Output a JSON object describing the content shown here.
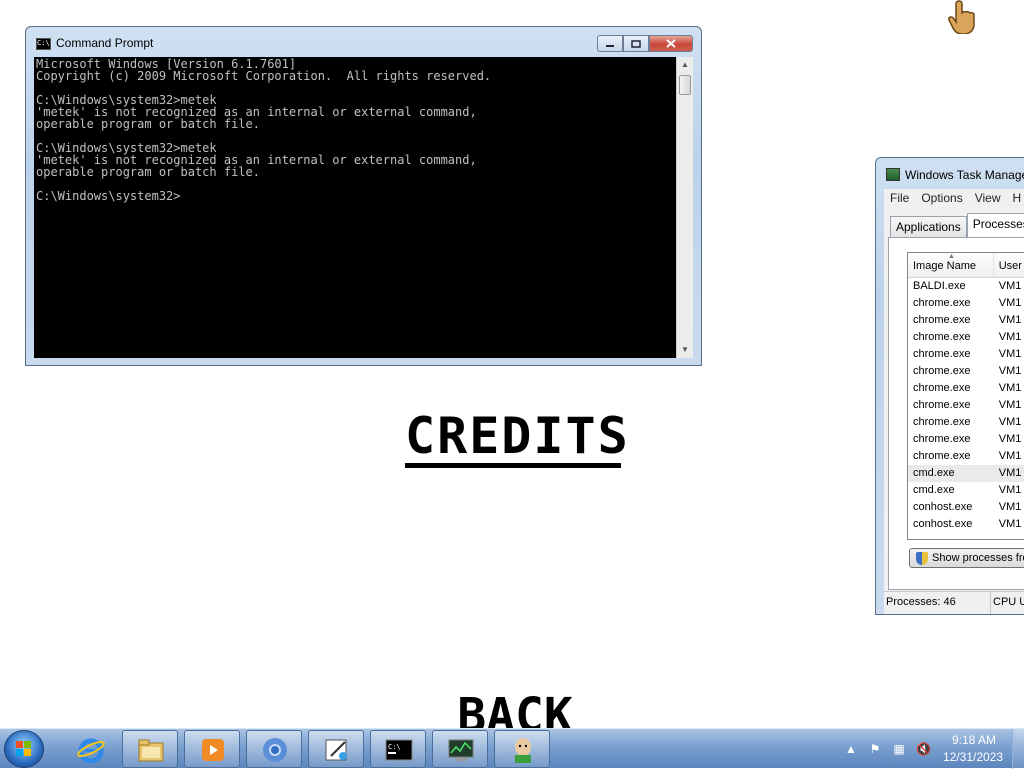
{
  "game": {
    "credits_title": "CREDITS",
    "back_label": "BACK"
  },
  "cmd": {
    "title": "Command Prompt",
    "icon": "cmd-icon",
    "lines": [
      "Microsoft Windows [Version 6.1.7601]",
      "Copyright (c) 2009 Microsoft Corporation.  All rights reserved.",
      "",
      "C:\\Windows\\system32>metek",
      "'metek' is not recognized as an internal or external command,",
      "operable program or batch file.",
      "",
      "C:\\Windows\\system32>metek",
      "'metek' is not recognized as an internal or external command,",
      "operable program or batch file.",
      "",
      "C:\\Windows\\system32>"
    ]
  },
  "taskmgr": {
    "title": "Windows Task Manage",
    "menu": [
      "File",
      "Options",
      "View",
      "H"
    ],
    "tabs": [
      "Applications",
      "Processes"
    ],
    "active_tab": "Processes",
    "columns": [
      "Image Name",
      "User"
    ],
    "rows": [
      {
        "name": "BALDI.exe",
        "user": "VM1"
      },
      {
        "name": "chrome.exe",
        "user": "VM1"
      },
      {
        "name": "chrome.exe",
        "user": "VM1"
      },
      {
        "name": "chrome.exe",
        "user": "VM1"
      },
      {
        "name": "chrome.exe",
        "user": "VM1"
      },
      {
        "name": "chrome.exe",
        "user": "VM1"
      },
      {
        "name": "chrome.exe",
        "user": "VM1"
      },
      {
        "name": "chrome.exe",
        "user": "VM1"
      },
      {
        "name": "chrome.exe",
        "user": "VM1"
      },
      {
        "name": "chrome.exe",
        "user": "VM1"
      },
      {
        "name": "chrome.exe",
        "user": "VM1"
      },
      {
        "name": "cmd.exe",
        "user": "VM1",
        "selected": true
      },
      {
        "name": "cmd.exe",
        "user": "VM1"
      },
      {
        "name": "conhost.exe",
        "user": "VM1"
      },
      {
        "name": "conhost.exe",
        "user": "VM1"
      }
    ],
    "show_processes_label": "Show processes fro",
    "status_processes": "Processes: 46",
    "status_cpu": "CPU U"
  },
  "taskbar": {
    "pinned": [
      "internet-explorer-icon",
      "windows-explorer-icon",
      "media-player-icon",
      "chrome-icon",
      "snipping-tool-icon",
      "cmd-icon",
      "task-manager-icon",
      "baldi-icon"
    ],
    "clock_time": "9:18 AM",
    "clock_date": "12/31/2023"
  },
  "colors": {
    "console_bg": "#000000",
    "console_text": "#c0c0c0",
    "taskbar": "#6a93c6",
    "close_button": "#c8473a"
  }
}
